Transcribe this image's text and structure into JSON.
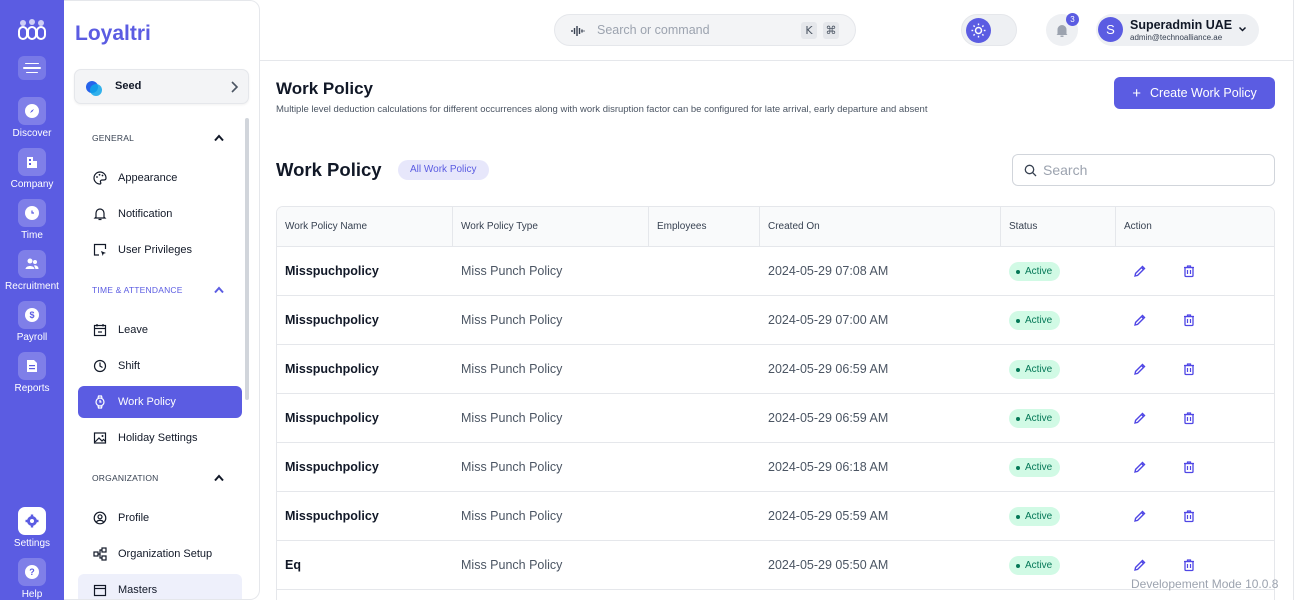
{
  "rail": {
    "items": [
      {
        "label": "Discover",
        "icon": "compass-icon"
      },
      {
        "label": "Company",
        "icon": "building-icon"
      },
      {
        "label": "Time",
        "icon": "clock-icon"
      },
      {
        "label": "Recruitment",
        "icon": "users-icon"
      },
      {
        "label": "Payroll",
        "icon": "dollar-icon"
      },
      {
        "label": "Reports",
        "icon": "document-icon"
      }
    ],
    "bottom": [
      {
        "label": "Settings",
        "icon": "gear-icon"
      },
      {
        "label": "Help",
        "icon": "question-icon"
      }
    ]
  },
  "sidebar": {
    "brand": "Loyaltri",
    "workspace": "Seed",
    "sections": [
      {
        "title": "GENERAL",
        "items": [
          "Appearance",
          "Notification",
          "User Privileges"
        ]
      },
      {
        "title": "TIME & ATTENDANCE",
        "items": [
          "Leave",
          "Shift",
          "Work Policy",
          "Holiday Settings"
        ]
      },
      {
        "title": "ORGANIZATION",
        "items": [
          "Profile",
          "Organization Setup",
          "Masters"
        ]
      }
    ]
  },
  "topbar": {
    "search_placeholder": "Search or command",
    "kbd_k": "K",
    "kbd_cmd": "⌘",
    "notification_count": "3",
    "user_initial": "S",
    "user_name": "Superadmin UAE",
    "user_email": "admin@technoalliance.ae"
  },
  "page": {
    "title": "Work Policy",
    "description": "Multiple level deduction calculations for different occurrences along with work disruption factor can be configured for late arrival, early departure and absent",
    "create_label": "Create Work Policy",
    "list_title": "Work Policy",
    "filter_label": "All Work Policy",
    "search_placeholder": "Search"
  },
  "table": {
    "columns": [
      "Work Policy Name",
      "Work Policy Type",
      "Employees",
      "Created On",
      "Status",
      "Action"
    ],
    "rows": [
      {
        "name": "Misspuchpolicy",
        "type": "Miss Punch Policy",
        "employees": "",
        "created": "2024-05-29 07:08 AM",
        "status": "Active"
      },
      {
        "name": "Misspuchpolicy",
        "type": "Miss Punch Policy",
        "employees": "",
        "created": "2024-05-29 07:00 AM",
        "status": "Active"
      },
      {
        "name": "Misspuchpolicy",
        "type": "Miss Punch Policy",
        "employees": "",
        "created": "2024-05-29 06:59 AM",
        "status": "Active"
      },
      {
        "name": "Misspuchpolicy",
        "type": "Miss Punch Policy",
        "employees": "",
        "created": "2024-05-29 06:59 AM",
        "status": "Active"
      },
      {
        "name": "Misspuchpolicy",
        "type": "Miss Punch Policy",
        "employees": "",
        "created": "2024-05-29 06:18 AM",
        "status": "Active"
      },
      {
        "name": "Misspuchpolicy",
        "type": "Miss Punch Policy",
        "employees": "",
        "created": "2024-05-29 05:59 AM",
        "status": "Active"
      },
      {
        "name": "Eq",
        "type": "Miss Punch Policy",
        "employees": "",
        "created": "2024-05-29 05:50 AM",
        "status": "Active"
      }
    ]
  },
  "footer": {
    "dev_mode": "Developement Mode 10.0.8"
  },
  "colors": {
    "accent": "#5b5ce2",
    "active_bg": "#d1fae5",
    "active_text": "#047857"
  }
}
